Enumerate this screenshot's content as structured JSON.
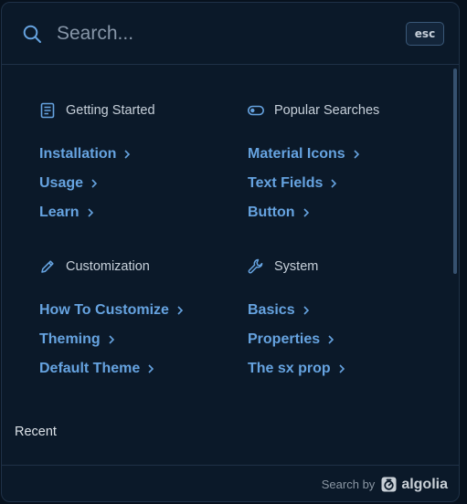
{
  "search": {
    "placeholder": "Search...",
    "esc_label": "esc"
  },
  "sections": [
    {
      "title": "Getting Started",
      "icon": "article-icon",
      "links": [
        "Installation",
        "Usage",
        "Learn"
      ]
    },
    {
      "title": "Popular Searches",
      "icon": "toggle-icon",
      "links": [
        "Material Icons",
        "Text Fields",
        "Button"
      ]
    },
    {
      "title": "Customization",
      "icon": "pencil-icon",
      "links": [
        "How To Customize",
        "Theming",
        "Default Theme"
      ]
    },
    {
      "title": "System",
      "icon": "wrench-icon",
      "links": [
        "Basics",
        "Properties",
        "The sx prop"
      ]
    }
  ],
  "recent": {
    "label": "Recent"
  },
  "footer": {
    "search_by": "Search by",
    "brand": "algolia"
  },
  "colors": {
    "background": "#0b1929",
    "link": "#66a3e0",
    "border": "#1f3147",
    "accent_icon": "#66a3e0"
  }
}
